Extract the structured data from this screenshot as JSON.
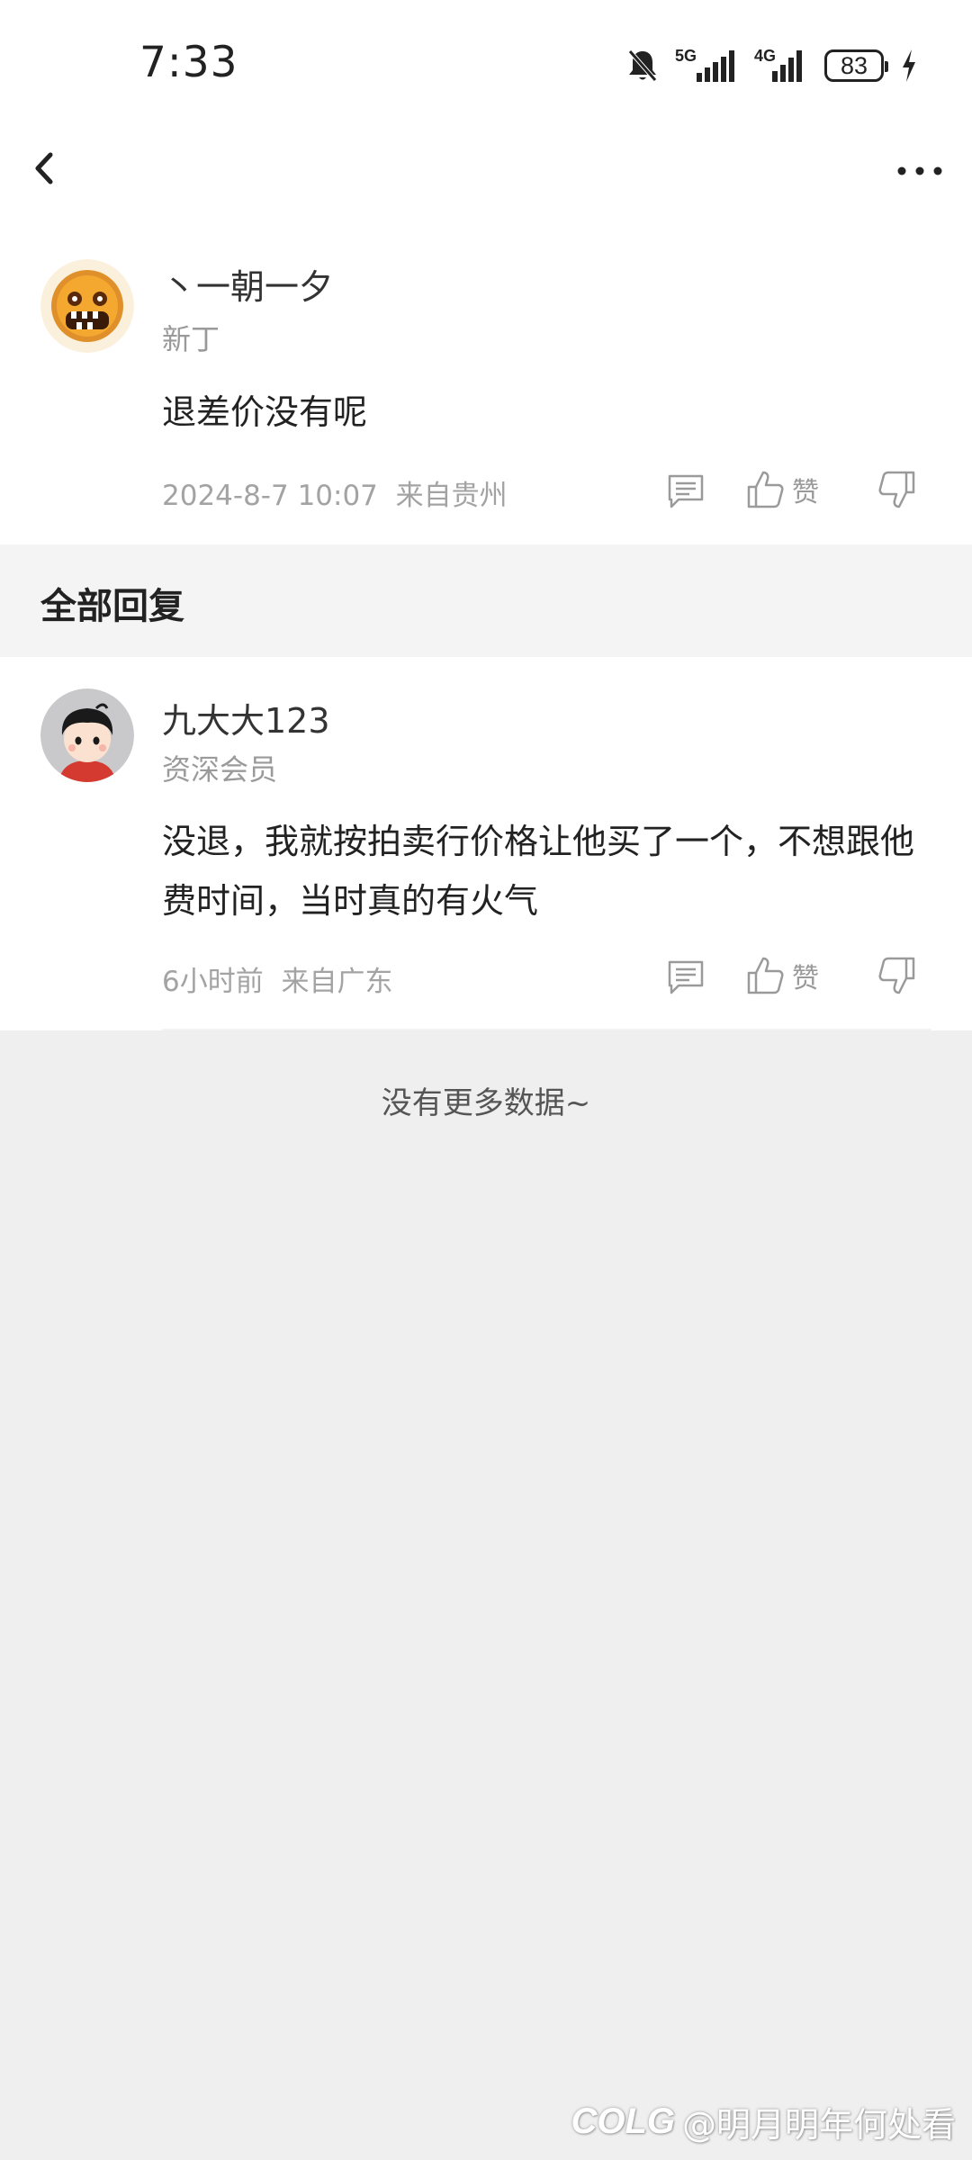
{
  "status_bar": {
    "time": "7:33",
    "network_5g": "5G",
    "network_4g": "4G",
    "battery": "83"
  },
  "nav": {
    "back_icon": "chevron-left-icon",
    "more_icon": "more-dots-icon"
  },
  "main_comment": {
    "username": "丶一朝一夕",
    "level": "新丁",
    "text": "退差价没有呢",
    "time": "2024-8-7 10:07",
    "location": "来自贵州",
    "like_label": "赞"
  },
  "replies_section": {
    "title": "全部回复"
  },
  "replies": [
    {
      "username": "九大大123",
      "level": "资深会员",
      "text": "没退，我就按拍卖行价格让他买了一个，不想跟他费时间，当时真的有火气",
      "time": "6小时前",
      "location": "来自广东",
      "like_label": "赞"
    }
  ],
  "footer": {
    "no_more": "没有更多数据~"
  },
  "watermark": {
    "logo": "COLG",
    "text": "@明月明年何处看"
  },
  "colors": {
    "background": "#efefef",
    "card": "#ffffff",
    "muted_text": "#a3a3a3",
    "primary_text": "#222222"
  }
}
